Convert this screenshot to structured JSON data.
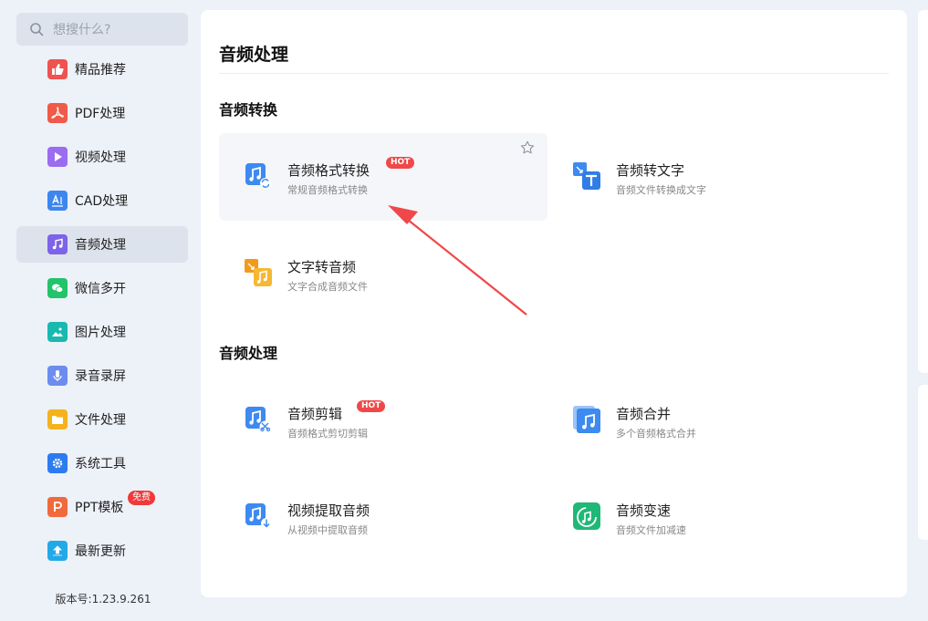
{
  "search": {
    "placeholder": "想搜什么?"
  },
  "sidebar": {
    "items": [
      {
        "label": "精品推荐",
        "icon": "thumbs-up-icon",
        "color": "#f0524f"
      },
      {
        "label": "PDF处理",
        "icon": "pdf-icon",
        "color": "#ef5b48"
      },
      {
        "label": "视频处理",
        "icon": "play-icon",
        "color": "#9b6cf0"
      },
      {
        "label": "CAD处理",
        "icon": "cad-icon",
        "color": "#3d86f0"
      },
      {
        "label": "音频处理",
        "icon": "music-note-icon",
        "color": "#7d63e8"
      },
      {
        "label": "微信多开",
        "icon": "wechat-icon",
        "color": "#22c36a"
      },
      {
        "label": "图片处理",
        "icon": "image-icon",
        "color": "#19b9b0"
      },
      {
        "label": "录音录屏",
        "icon": "microphone-icon",
        "color": "#6d8cf0"
      },
      {
        "label": "文件处理",
        "icon": "folder-icon",
        "color": "#f5b21b"
      },
      {
        "label": "系统工具",
        "icon": "gear-icon",
        "color": "#2c7cf0"
      },
      {
        "label": "PPT模板",
        "icon": "ppt-icon",
        "color": "#f06a3c",
        "badge": "免费"
      },
      {
        "label": "最新更新",
        "icon": "upload-icon",
        "color": "#22a9e8"
      }
    ],
    "active_index": 4,
    "version": "版本号:1.23.9.261"
  },
  "main": {
    "title": "音频处理",
    "sections": [
      {
        "title": "音频转换",
        "cards": [
          {
            "title": "音频格式转换",
            "desc": "常规音频格式转换",
            "icon": "audio-convert-icon",
            "hot": "HOT",
            "highlight": true
          },
          {
            "title": "音频转文字",
            "desc": "音频文件转换成文字",
            "icon": "audio-to-text-icon"
          },
          {
            "title": "文字转音频",
            "desc": "文字合成音频文件",
            "icon": "text-to-audio-icon"
          }
        ]
      },
      {
        "title": "音频处理",
        "cards": [
          {
            "title": "音频剪辑",
            "desc": "音频格式剪切剪辑",
            "icon": "audio-cut-icon",
            "hot": "HOT"
          },
          {
            "title": "音频合并",
            "desc": "多个音频格式合并",
            "icon": "audio-merge-icon"
          },
          {
            "title": "视频提取音频",
            "desc": "从视频中提取音频",
            "icon": "video-extract-audio-icon"
          },
          {
            "title": "音频变速",
            "desc": "音频文件加减速",
            "icon": "audio-speed-icon"
          }
        ]
      }
    ]
  },
  "colors": {
    "accent_blue": "#3d8af0",
    "hot_red": "#f04848",
    "arrow_red": "#f0474a"
  }
}
